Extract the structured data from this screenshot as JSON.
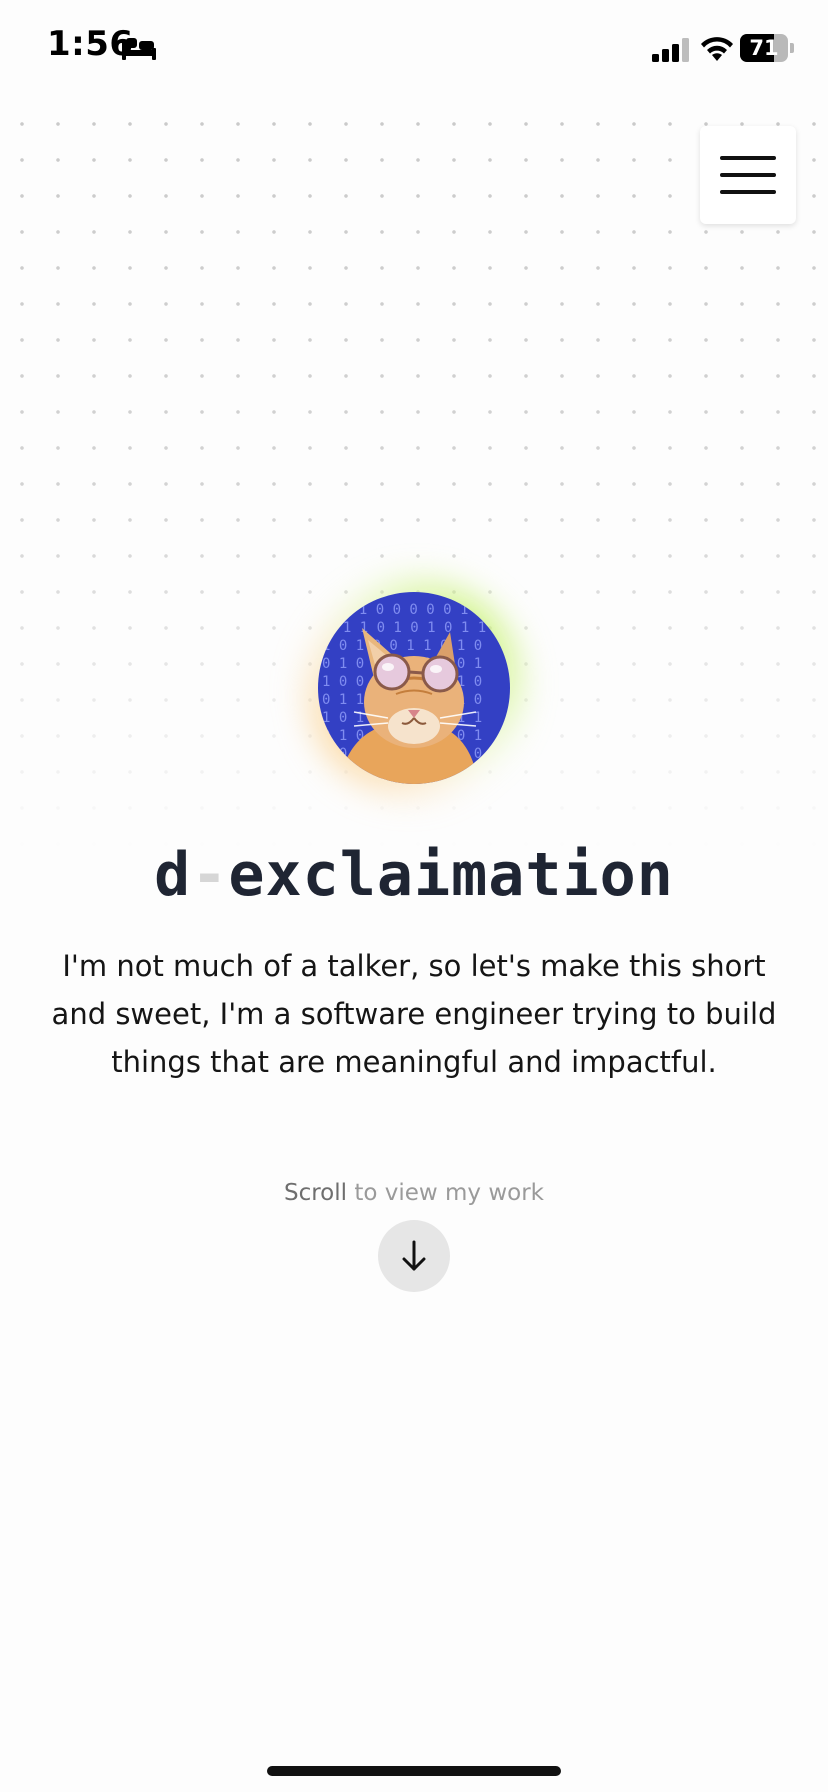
{
  "status_bar": {
    "time": "1:56",
    "focus_icon": "bed-icon",
    "signal_icon": "cellular-signal-icon",
    "wifi_icon": "wifi-icon",
    "battery_level": "71",
    "battery_fraction": 0.71
  },
  "header": {
    "menu_icon": "hamburger-menu-icon"
  },
  "hero": {
    "avatar_icon": "cat-with-sunglasses-avatar",
    "name_part1": "d",
    "name_dash": "-",
    "name_part2": "exclaimation",
    "bio": "I'm not much of a talker, so let's make this short and sweet, I'm a software engineer trying to build things that are meaningful and impactful.",
    "scroll_word": "Scroll",
    "scroll_rest": " to view my work",
    "scroll_icon": "arrow-down-icon"
  },
  "colors": {
    "background": "#fdfdfd",
    "title": "#1f2533",
    "dash": "#d6d6d6",
    "muted_text": "#9a9a9a",
    "scroll_button_bg": "#e6e6e6",
    "avatar_bg": "#3340c4",
    "glow_green": "#bef05a",
    "glow_orange": "#fac878"
  }
}
